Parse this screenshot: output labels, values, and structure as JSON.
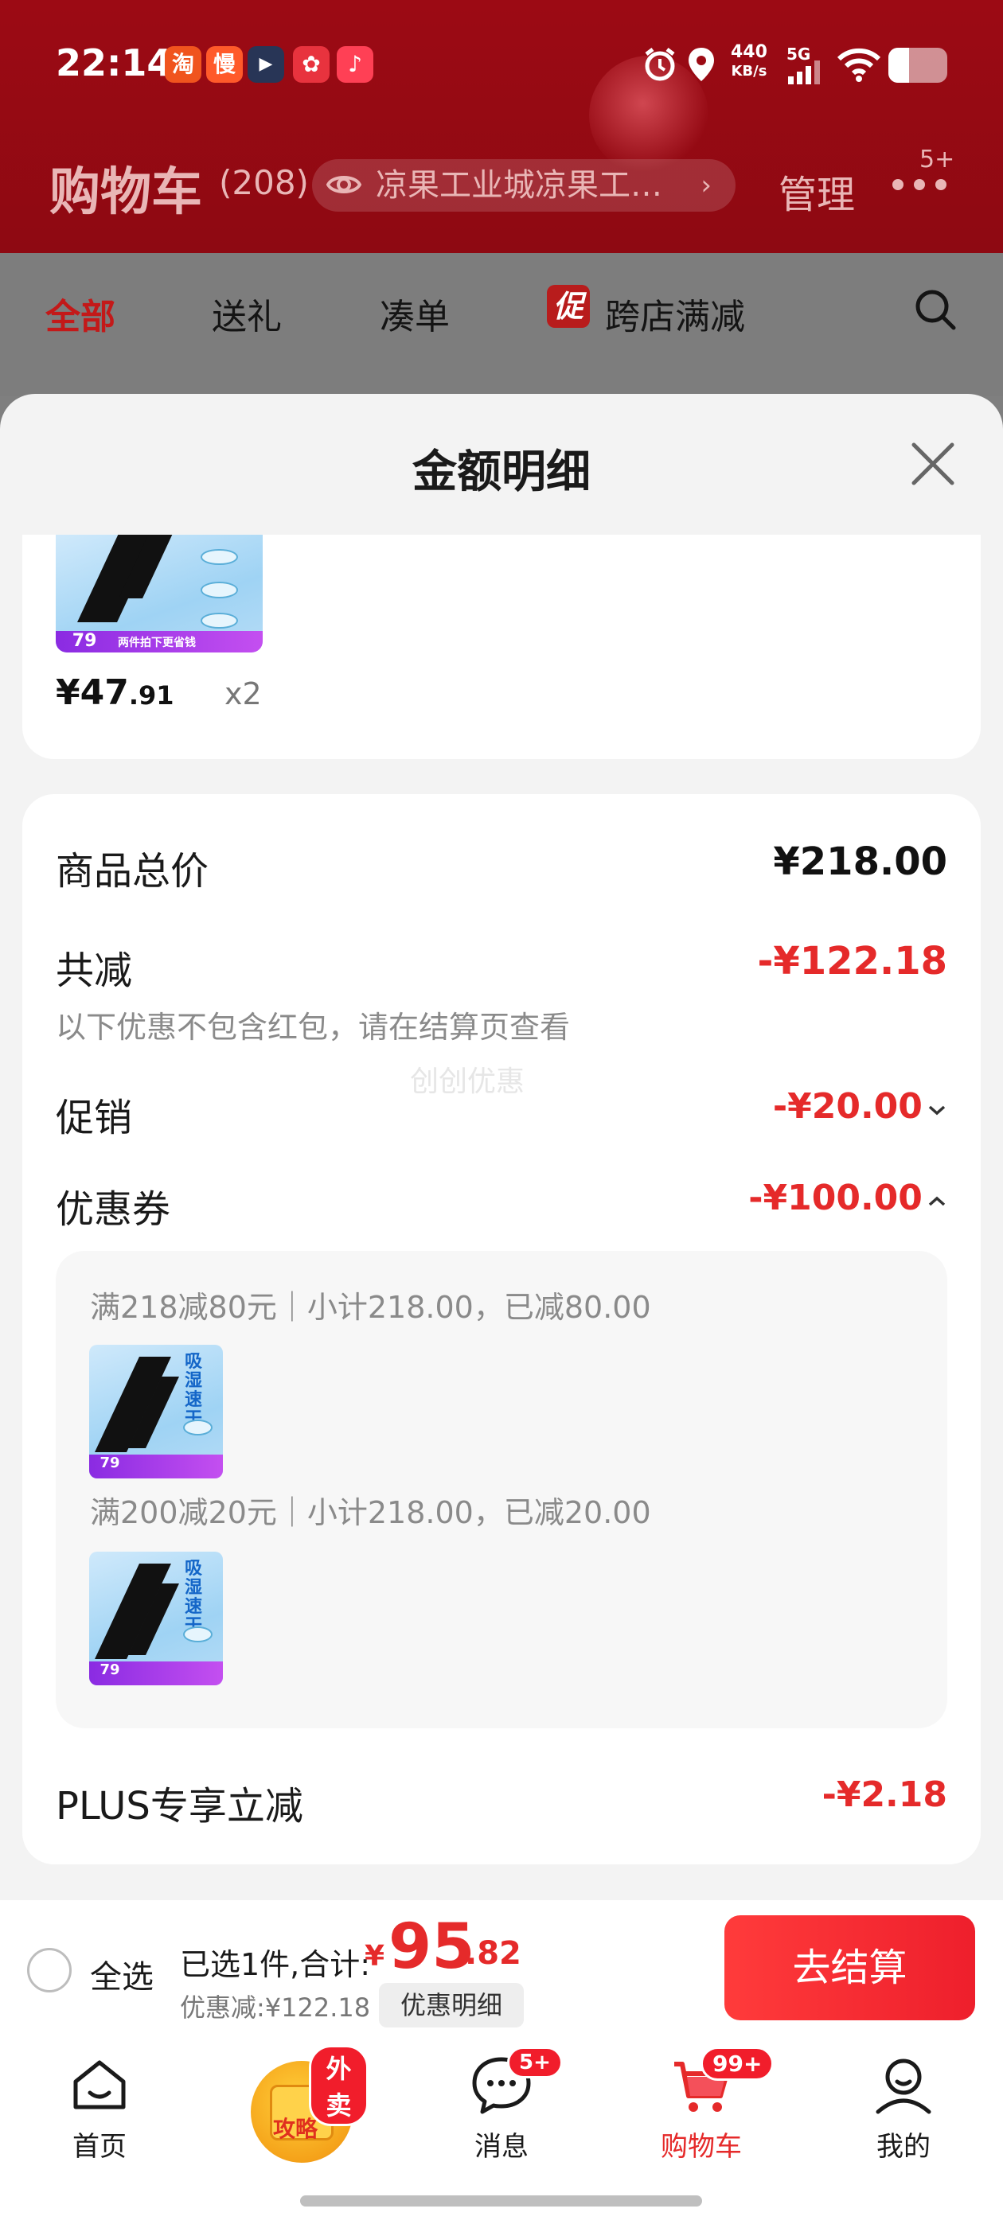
{
  "status_bar": {
    "time": "22:14",
    "app_icons": [
      {
        "name": "taobao-app-icon",
        "glyph": "淘",
        "color": "#f0541e"
      },
      {
        "name": "xianyu-app-icon",
        "glyph": "慢",
        "color": "#ff5a2a"
      },
      {
        "name": "video-app-icon",
        "glyph": "▶",
        "color": "#283556"
      },
      {
        "name": "ai-app-icon",
        "glyph": "✿",
        "color": "#e8333e"
      },
      {
        "name": "music-app-icon",
        "glyph": "♪",
        "color": "#ff4055"
      }
    ],
    "net_speed_value": "440",
    "net_speed_unit": "KB/s",
    "net_type": "5G"
  },
  "header": {
    "title": "购物车",
    "count": "(208)",
    "address": "凉果工业城凉果工…",
    "manage": "管理",
    "more_badge": "5+"
  },
  "tabs": [
    {
      "label": "全部",
      "active": true
    },
    {
      "label": "送礼",
      "active": false
    },
    {
      "label": "凑单",
      "active": false
    },
    {
      "label": "跨店满减",
      "active": false,
      "badge": "促"
    }
  ],
  "sheet": {
    "title": "金额明细",
    "item": {
      "price_int": "¥47",
      "price_dec": ".91",
      "qty": "x2",
      "thumb_tag": "79",
      "thumb_caption": "两件拍下更省钱"
    },
    "summary": {
      "total_label": "商品总价",
      "total_value": "¥218.00",
      "reduce_label": "共减",
      "reduce_value": "-¥122.18",
      "reduce_note": "以下优惠不包含红包，请在结算页查看",
      "watermark": "创创优惠",
      "promo_label": "促销",
      "promo_value": "-¥20.00",
      "coupon_label": "优惠券",
      "coupon_value": "-¥100.00",
      "plus_label": "PLUS专享立减",
      "plus_value": "-¥2.18"
    },
    "coupons": [
      {
        "text": "满218减80元｜小计218.00，已减80.00",
        "thumb_title": "吸湿速干"
      },
      {
        "text": "满200减20元｜小计218.00，已减20.00",
        "thumb_title": "吸湿速干"
      }
    ]
  },
  "checkout": {
    "select_all": "全选",
    "selected_prefix": "已选1件,合计:",
    "currency": "¥",
    "total_int": "95",
    "total_dec": ".82",
    "discount": "优惠减:¥122.18",
    "detail_btn": "优惠明细",
    "go_btn": "去结算"
  },
  "nav": {
    "items": [
      {
        "label": "首页",
        "icon": "home-icon"
      },
      {
        "label": "攻略",
        "icon": "guide-bag-icon",
        "badge": "外卖"
      },
      {
        "label": "消息",
        "icon": "message-icon",
        "badge": "5+"
      },
      {
        "label": "购物车",
        "icon": "cart-icon",
        "badge": "99+",
        "active": true
      },
      {
        "label": "我的",
        "icon": "profile-icon"
      }
    ]
  },
  "colors": {
    "brand_red": "#e52a2a",
    "header_red": "#9c0a14",
    "active_tab": "#c31919"
  }
}
